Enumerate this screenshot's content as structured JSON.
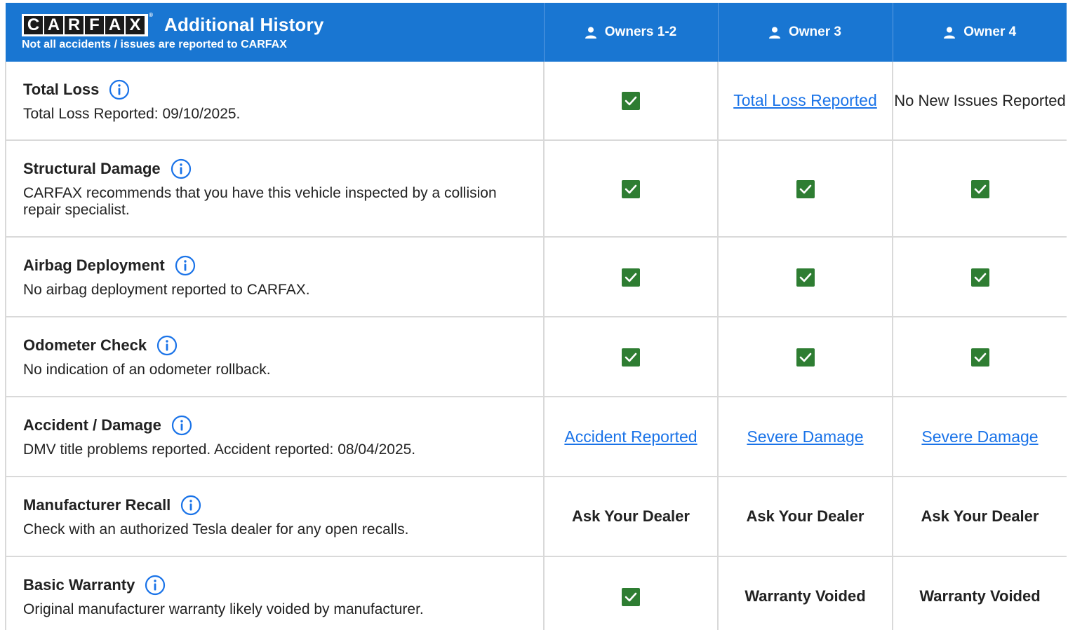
{
  "header": {
    "logo_letters": [
      "C",
      "A",
      "R",
      "F",
      "A",
      "X"
    ],
    "title": "Additional History",
    "subtitle": "Not all accidents / issues are reported to CARFAX",
    "owners": [
      "Owners 1-2",
      "Owner 3",
      "Owner 4"
    ]
  },
  "colors": {
    "header_bg": "#1976d2",
    "check_green": "#2e7d32",
    "link_blue": "#1a73e8",
    "border": "#d9d9d9"
  },
  "rows": [
    {
      "title": "Total Loss",
      "desc": "Total Loss Reported: 09/10/2025.",
      "cells": [
        {
          "type": "check"
        },
        {
          "type": "link",
          "text": "Total Loss Reported"
        },
        {
          "type": "text",
          "text": "No New Issues Reported"
        }
      ]
    },
    {
      "title": "Structural Damage",
      "desc": "CARFAX recommends that you have this vehicle inspected by a collision repair specialist.",
      "cells": [
        {
          "type": "check"
        },
        {
          "type": "check"
        },
        {
          "type": "check"
        }
      ]
    },
    {
      "title": "Airbag Deployment",
      "desc": "No airbag deployment reported to CARFAX.",
      "cells": [
        {
          "type": "check"
        },
        {
          "type": "check"
        },
        {
          "type": "check"
        }
      ]
    },
    {
      "title": "Odometer Check",
      "desc": "No indication of an odometer rollback.",
      "cells": [
        {
          "type": "check"
        },
        {
          "type": "check"
        },
        {
          "type": "check"
        }
      ]
    },
    {
      "title": "Accident / Damage",
      "desc": "DMV title problems reported. Accident reported: 08/04/2025.",
      "cells": [
        {
          "type": "link",
          "text": "Accident Reported"
        },
        {
          "type": "link",
          "text": "Severe Damage"
        },
        {
          "type": "link",
          "text": "Severe Damage"
        }
      ]
    },
    {
      "title": "Manufacturer Recall",
      "desc": "Check with an authorized Tesla dealer for any open recalls.",
      "cells": [
        {
          "type": "bold",
          "text": "Ask Your Dealer"
        },
        {
          "type": "bold",
          "text": "Ask Your Dealer"
        },
        {
          "type": "bold",
          "text": "Ask Your Dealer"
        }
      ]
    },
    {
      "title": "Basic Warranty",
      "desc": "Original manufacturer warranty likely voided by manufacturer.",
      "cells": [
        {
          "type": "check"
        },
        {
          "type": "bold",
          "text": "Warranty Voided"
        },
        {
          "type": "bold",
          "text": "Warranty Voided"
        }
      ]
    }
  ]
}
